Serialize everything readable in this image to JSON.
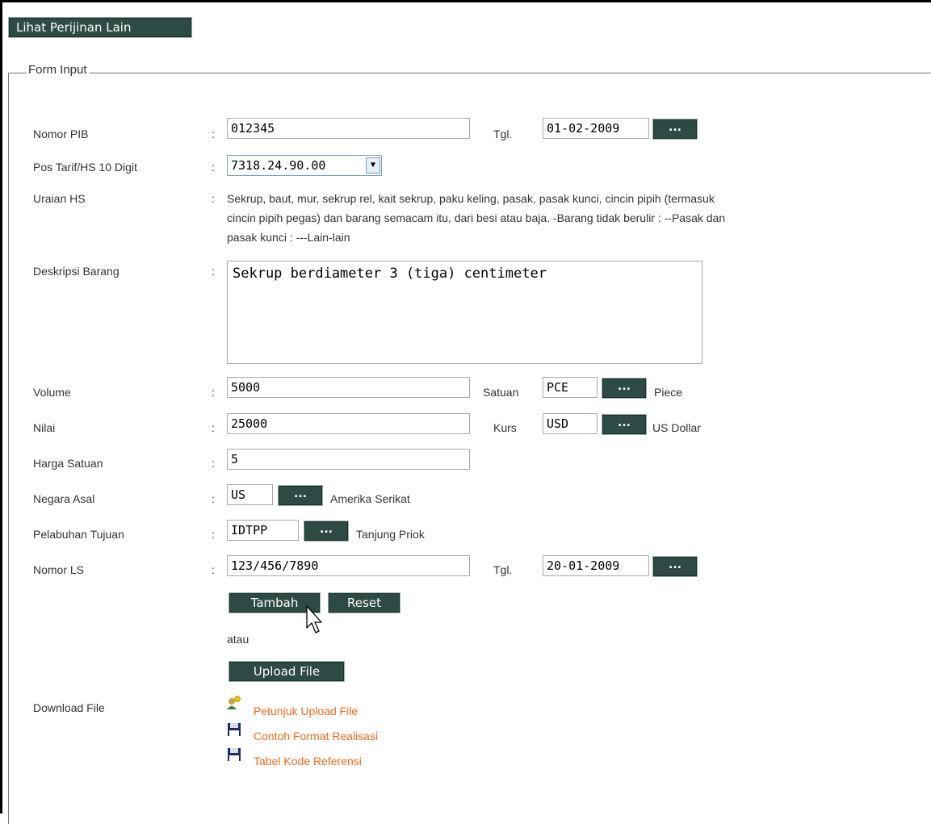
{
  "top_button": "Lihat Perijinan Lain",
  "legend": "Form Input",
  "rows": {
    "nomor_pib": {
      "label": "Nomor PIB",
      "value": "012345",
      "tgl_label": "Tgl.",
      "tgl_value": "01-02-2009"
    },
    "pos_tarif": {
      "label": "Pos Tarif/HS 10 Digit",
      "value": "7318.24.90.00"
    },
    "uraian_hs": {
      "label": "Uraian HS",
      "line1": "Sekrup, baut, mur, sekrup rel, kait sekrup, paku keling, pasak, pasak kunci, cincin pipih (termasuk",
      "line2": "cincin pipih pegas) dan barang semacam itu, dari besi atau baja. -Barang tidak berulir : --Pasak dan",
      "line3": "pasak kunci : ---Lain-lain"
    },
    "deskripsi": {
      "label": "Deskripsi Barang",
      "value": "Sekrup berdiameter 3 (tiga) centimeter"
    },
    "volume": {
      "label": "Volume",
      "value": "5000",
      "satuan_label": "Satuan",
      "satuan_code": "PCE",
      "satuan_name": "Piece"
    },
    "nilai": {
      "label": "Nilai",
      "value": "25000",
      "kurs_label": "Kurs",
      "kurs_code": "USD",
      "kurs_name": "US Dollar"
    },
    "harga_satuan": {
      "label": "Harga Satuan",
      "value": "5"
    },
    "negara_asal": {
      "label": "Negara Asal",
      "code": "US",
      "name": "Amerika Serikat"
    },
    "pelabuhan": {
      "label": "Pelabuhan Tujuan",
      "code": "IDTPP",
      "name": "Tanjung Priok"
    },
    "nomor_ls": {
      "label": "Nomor LS",
      "value": "123/456/7890",
      "tgl_label": "Tgl.",
      "tgl_value": "20-01-2009"
    }
  },
  "colon": ":",
  "browse_label": "...",
  "buttons": {
    "tambah": "Tambah",
    "reset": "Reset",
    "atau": "atau",
    "upload": "Upload File"
  },
  "download": {
    "label": "Download File",
    "links": [
      {
        "text": "Petunjuk Upload File",
        "icon": "help-user-icon"
      },
      {
        "text": "Contoh Format Realisasi",
        "icon": "floppy-disk-icon"
      },
      {
        "text": "Tabel Kode Referensi",
        "icon": "floppy-disk-icon"
      }
    ]
  },
  "colors": {
    "button_bg": "#2e4a44",
    "link": "#f26a1b",
    "text": "#333333"
  }
}
